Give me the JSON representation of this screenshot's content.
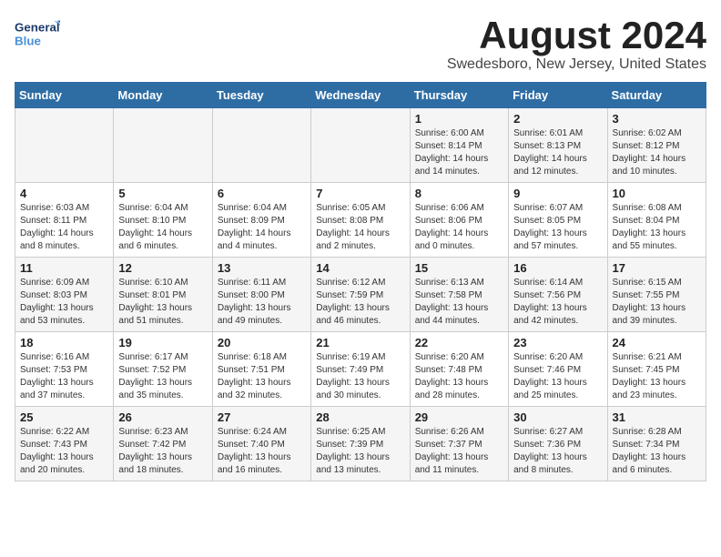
{
  "logo": {
    "general": "General",
    "blue": "Blue"
  },
  "title": "August 2024",
  "subtitle": "Swedesboro, New Jersey, United States",
  "headers": [
    "Sunday",
    "Monday",
    "Tuesday",
    "Wednesday",
    "Thursday",
    "Friday",
    "Saturday"
  ],
  "weeks": [
    [
      {
        "day": "",
        "info": ""
      },
      {
        "day": "",
        "info": ""
      },
      {
        "day": "",
        "info": ""
      },
      {
        "day": "",
        "info": ""
      },
      {
        "day": "1",
        "info": "Sunrise: 6:00 AM\nSunset: 8:14 PM\nDaylight: 14 hours\nand 14 minutes."
      },
      {
        "day": "2",
        "info": "Sunrise: 6:01 AM\nSunset: 8:13 PM\nDaylight: 14 hours\nand 12 minutes."
      },
      {
        "day": "3",
        "info": "Sunrise: 6:02 AM\nSunset: 8:12 PM\nDaylight: 14 hours\nand 10 minutes."
      }
    ],
    [
      {
        "day": "4",
        "info": "Sunrise: 6:03 AM\nSunset: 8:11 PM\nDaylight: 14 hours\nand 8 minutes."
      },
      {
        "day": "5",
        "info": "Sunrise: 6:04 AM\nSunset: 8:10 PM\nDaylight: 14 hours\nand 6 minutes."
      },
      {
        "day": "6",
        "info": "Sunrise: 6:04 AM\nSunset: 8:09 PM\nDaylight: 14 hours\nand 4 minutes."
      },
      {
        "day": "7",
        "info": "Sunrise: 6:05 AM\nSunset: 8:08 PM\nDaylight: 14 hours\nand 2 minutes."
      },
      {
        "day": "8",
        "info": "Sunrise: 6:06 AM\nSunset: 8:06 PM\nDaylight: 14 hours\nand 0 minutes."
      },
      {
        "day": "9",
        "info": "Sunrise: 6:07 AM\nSunset: 8:05 PM\nDaylight: 13 hours\nand 57 minutes."
      },
      {
        "day": "10",
        "info": "Sunrise: 6:08 AM\nSunset: 8:04 PM\nDaylight: 13 hours\nand 55 minutes."
      }
    ],
    [
      {
        "day": "11",
        "info": "Sunrise: 6:09 AM\nSunset: 8:03 PM\nDaylight: 13 hours\nand 53 minutes."
      },
      {
        "day": "12",
        "info": "Sunrise: 6:10 AM\nSunset: 8:01 PM\nDaylight: 13 hours\nand 51 minutes."
      },
      {
        "day": "13",
        "info": "Sunrise: 6:11 AM\nSunset: 8:00 PM\nDaylight: 13 hours\nand 49 minutes."
      },
      {
        "day": "14",
        "info": "Sunrise: 6:12 AM\nSunset: 7:59 PM\nDaylight: 13 hours\nand 46 minutes."
      },
      {
        "day": "15",
        "info": "Sunrise: 6:13 AM\nSunset: 7:58 PM\nDaylight: 13 hours\nand 44 minutes."
      },
      {
        "day": "16",
        "info": "Sunrise: 6:14 AM\nSunset: 7:56 PM\nDaylight: 13 hours\nand 42 minutes."
      },
      {
        "day": "17",
        "info": "Sunrise: 6:15 AM\nSunset: 7:55 PM\nDaylight: 13 hours\nand 39 minutes."
      }
    ],
    [
      {
        "day": "18",
        "info": "Sunrise: 6:16 AM\nSunset: 7:53 PM\nDaylight: 13 hours\nand 37 minutes."
      },
      {
        "day": "19",
        "info": "Sunrise: 6:17 AM\nSunset: 7:52 PM\nDaylight: 13 hours\nand 35 minutes."
      },
      {
        "day": "20",
        "info": "Sunrise: 6:18 AM\nSunset: 7:51 PM\nDaylight: 13 hours\nand 32 minutes."
      },
      {
        "day": "21",
        "info": "Sunrise: 6:19 AM\nSunset: 7:49 PM\nDaylight: 13 hours\nand 30 minutes."
      },
      {
        "day": "22",
        "info": "Sunrise: 6:20 AM\nSunset: 7:48 PM\nDaylight: 13 hours\nand 28 minutes."
      },
      {
        "day": "23",
        "info": "Sunrise: 6:20 AM\nSunset: 7:46 PM\nDaylight: 13 hours\nand 25 minutes."
      },
      {
        "day": "24",
        "info": "Sunrise: 6:21 AM\nSunset: 7:45 PM\nDaylight: 13 hours\nand 23 minutes."
      }
    ],
    [
      {
        "day": "25",
        "info": "Sunrise: 6:22 AM\nSunset: 7:43 PM\nDaylight: 13 hours\nand 20 minutes."
      },
      {
        "day": "26",
        "info": "Sunrise: 6:23 AM\nSunset: 7:42 PM\nDaylight: 13 hours\nand 18 minutes."
      },
      {
        "day": "27",
        "info": "Sunrise: 6:24 AM\nSunset: 7:40 PM\nDaylight: 13 hours\nand 16 minutes."
      },
      {
        "day": "28",
        "info": "Sunrise: 6:25 AM\nSunset: 7:39 PM\nDaylight: 13 hours\nand 13 minutes."
      },
      {
        "day": "29",
        "info": "Sunrise: 6:26 AM\nSunset: 7:37 PM\nDaylight: 13 hours\nand 11 minutes."
      },
      {
        "day": "30",
        "info": "Sunrise: 6:27 AM\nSunset: 7:36 PM\nDaylight: 13 hours\nand 8 minutes."
      },
      {
        "day": "31",
        "info": "Sunrise: 6:28 AM\nSunset: 7:34 PM\nDaylight: 13 hours\nand 6 minutes."
      }
    ]
  ]
}
